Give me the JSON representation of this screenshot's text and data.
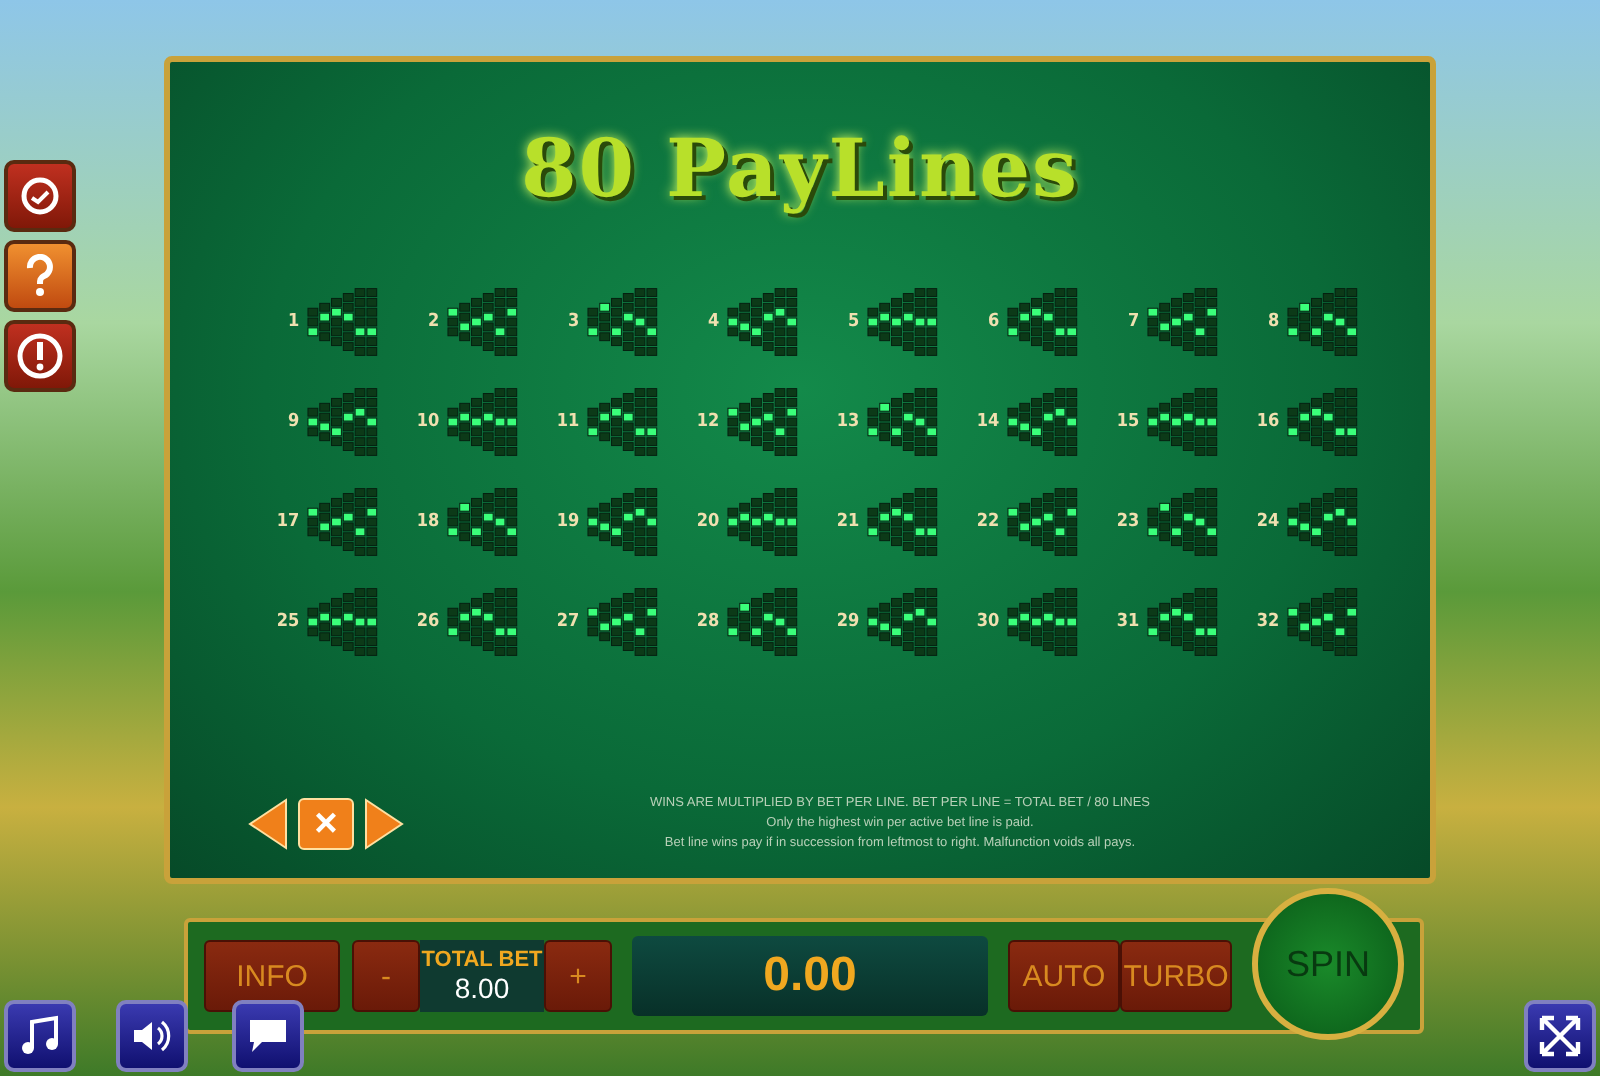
{
  "side_buttons": [
    {
      "kind": "history"
    },
    {
      "kind": "help"
    },
    {
      "kind": "info"
    }
  ],
  "title": "80 PayLines",
  "paylines": [
    "1",
    "2",
    "3",
    "4",
    "5",
    "6",
    "7",
    "8",
    "9",
    "10",
    "11",
    "12",
    "13",
    "14",
    "15",
    "16",
    "17",
    "18",
    "19",
    "20",
    "21",
    "22",
    "23",
    "24",
    "25",
    "26",
    "27",
    "28",
    "29",
    "30",
    "31",
    "32"
  ],
  "notes": [
    "WINS ARE MULTIPLIED BY BET PER LINE. BET PER LINE = TOTAL BET / 80 LINES",
    "Only the highest win per active bet line is paid.",
    "Bet line wins pay if in succession from leftmost to right. Malfunction voids all pays."
  ],
  "pager": {
    "close": "×"
  },
  "controls": {
    "info": "INFO",
    "minus": "-",
    "total_bet_label": "TOTAL BET",
    "total_bet": "8.00",
    "plus": "+",
    "win": "0.00",
    "auto": "AUTO",
    "turbo": "TURBO",
    "spin": "SPIN"
  }
}
